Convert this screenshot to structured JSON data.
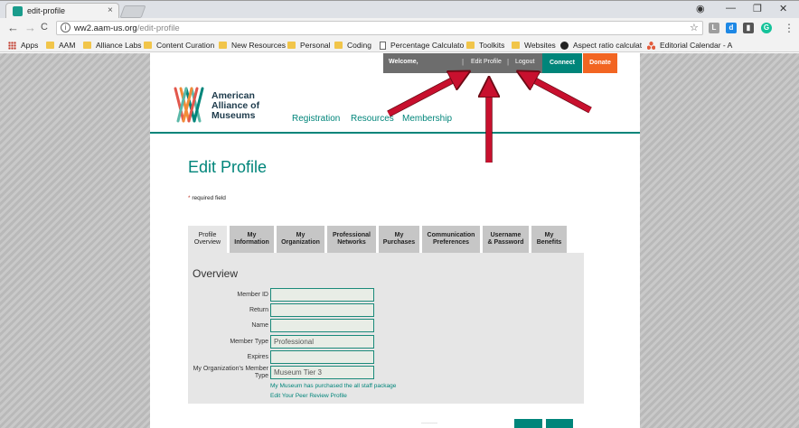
{
  "browser": {
    "tab_title": "edit-profile",
    "tab_close": "×",
    "url_host": "ww2.aam-us.org",
    "url_path": "/edit-profile",
    "back": "←",
    "forward": "→",
    "reload": "C",
    "star": "☆",
    "window_minimize": "—",
    "window_maximize": "❐",
    "window_close": "✕",
    "menu": "⋮",
    "profile": "◉",
    "extensions": [
      {
        "name": "ext-l",
        "label": "L",
        "color": "#9e9e9e"
      },
      {
        "name": "ext-d",
        "label": "d",
        "color": "#1e88e5"
      },
      {
        "name": "ext-bookmark",
        "label": "▮",
        "color": "#555555"
      },
      {
        "name": "ext-grammarly",
        "label": "G",
        "color": "#15c39a"
      }
    ],
    "bookmarks": [
      {
        "label": "Apps",
        "icon": "apps-icon"
      },
      {
        "label": "AAM",
        "icon": "folder-icon"
      },
      {
        "label": "Alliance Labs",
        "icon": "folder-icon"
      },
      {
        "label": "Content Curation",
        "icon": "folder-icon"
      },
      {
        "label": "New Resources",
        "icon": "folder-icon"
      },
      {
        "label": "Personal",
        "icon": "folder-icon"
      },
      {
        "label": "Coding",
        "icon": "folder-icon"
      },
      {
        "label": "Percentage Calculato",
        "icon": "doc-icon"
      },
      {
        "label": "Toolkits",
        "icon": "folder-icon"
      },
      {
        "label": "Websites",
        "icon": "folder-icon"
      },
      {
        "label": "Aspect ratio calculat",
        "icon": "globe-icon"
      },
      {
        "label": "Editorial Calendar - A",
        "icon": "tri-icon"
      }
    ]
  },
  "site": {
    "topbar": {
      "welcome": "Welcome,",
      "edit_profile": "Edit Profile",
      "logout": "Logout",
      "separator": "|",
      "connect": "Connect",
      "donate": "Donate"
    },
    "logo": {
      "line1": "American",
      "line2": "Alliance of",
      "line3": "Museums"
    },
    "nav": [
      "Registration",
      "Resources",
      "Membership"
    ],
    "page_title": "Edit Profile",
    "required_asterisk": "*",
    "required_note": " required field",
    "tabs": [
      {
        "line1": "Profile",
        "line2": "Overview"
      },
      {
        "line1": "My",
        "line2": "Information"
      },
      {
        "line1": "My",
        "line2": "Organization"
      },
      {
        "line1": "Professional",
        "line2": "Networks"
      },
      {
        "line1": "My",
        "line2": "Purchases"
      },
      {
        "line1": "Communication",
        "line2": "Preferences"
      },
      {
        "line1": "Username",
        "line2": "& Password"
      },
      {
        "line1": "My",
        "line2": "Benefits"
      }
    ],
    "overview": {
      "title": "Overview",
      "fields": [
        {
          "label": "Member ID",
          "value": ""
        },
        {
          "label": "Return",
          "value": ""
        },
        {
          "label": "Name",
          "value": ""
        },
        {
          "label": "Member Type",
          "value": "Professional"
        },
        {
          "label": "Expires",
          "value": ""
        },
        {
          "label": "My Organization's Member Type",
          "value": "Museum Tier 3"
        }
      ],
      "link_staff": "My Museum has purchased the all staff package",
      "link_peer": "Edit Your Peer Review Profile"
    }
  },
  "colors": {
    "brand_teal": "#00857a",
    "donate_orange": "#f26522",
    "annotation_red": "#c8102e"
  }
}
